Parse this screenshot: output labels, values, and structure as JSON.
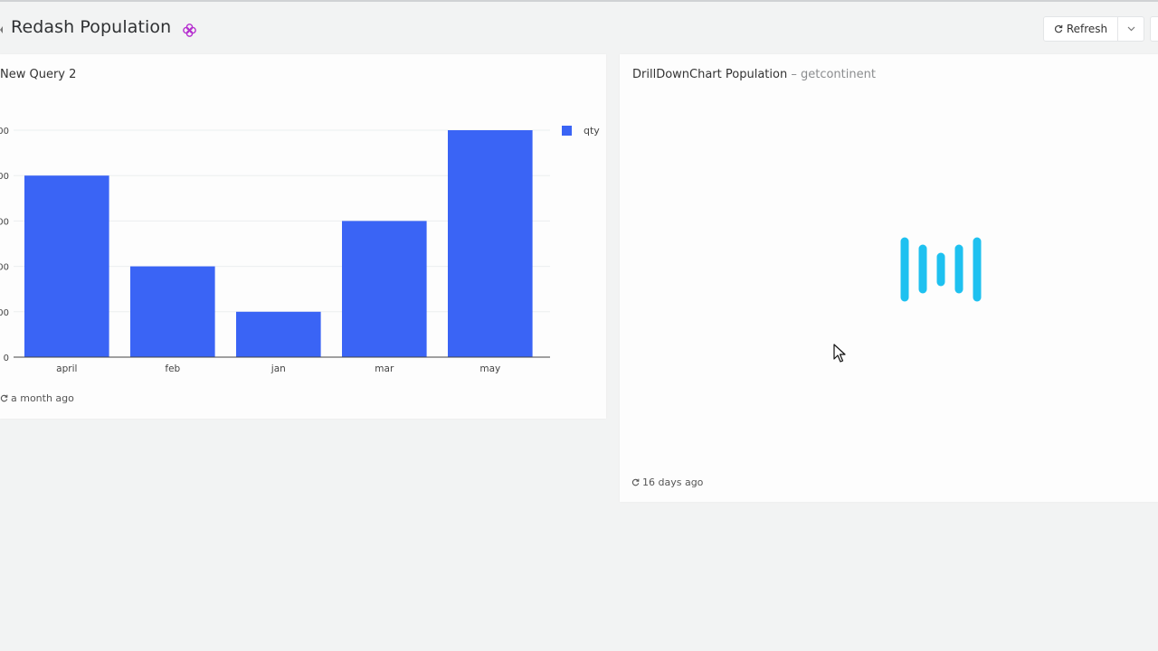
{
  "header": {
    "title": "Redash Population",
    "refresh_label": "Refresh"
  },
  "widgets": [
    {
      "title": "New Query 2",
      "subtitle": "",
      "footer": "a month ago"
    },
    {
      "title": "DrillDownChart Population",
      "separator": "–",
      "subtitle": "getcontinent",
      "footer": "16 days ago",
      "state": "loading"
    }
  ],
  "colors": {
    "bar": "#3a64f5",
    "loader": "#1ec1f0",
    "favorite": "#b52fcf"
  },
  "icons": [
    "favorite-icon",
    "refresh-icon",
    "chevron-down-icon",
    "loading-icon",
    "mouse-cursor-icon"
  ],
  "chart_data": {
    "type": "bar",
    "categories": [
      "april",
      "feb",
      "jan",
      "mar",
      "may"
    ],
    "series": [
      {
        "name": "qty",
        "values": [
          4,
          2,
          1,
          3,
          5
        ]
      }
    ],
    "ylim": [
      0,
      5
    ],
    "y_ticks": [
      "0",
      "00",
      "00",
      "00",
      "00",
      "00"
    ],
    "legend_position": "top-right",
    "grid": true,
    "xlabel": "",
    "ylabel": ""
  }
}
